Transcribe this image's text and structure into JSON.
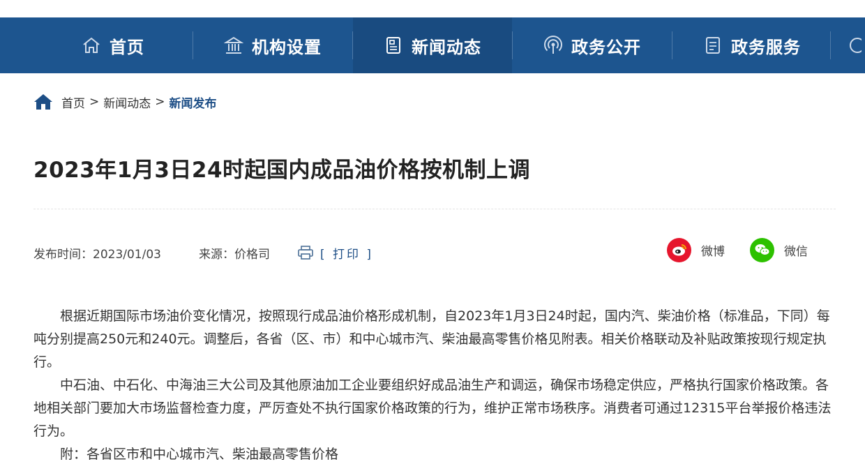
{
  "nav": {
    "items": [
      {
        "label": "首页",
        "icon": "home-outline-icon"
      },
      {
        "label": "机构设置",
        "icon": "institution-icon"
      },
      {
        "label": "新闻动态",
        "icon": "newspaper-icon"
      },
      {
        "label": "政务公开",
        "icon": "broadcast-icon"
      },
      {
        "label": "政务服务",
        "icon": "document-icon"
      }
    ],
    "active_label": "新闻动态"
  },
  "breadcrumb": {
    "home": "首页",
    "separator": ">",
    "section": "新闻动态",
    "current": "新闻发布"
  },
  "article": {
    "title": "2023年1月3日24时起国内成品油价格按机制上调",
    "publish_time": "发布时间：2023/01/03",
    "source": "来源：价格司",
    "print_label": "[ 打印 ]",
    "paragraphs": [
      "根据近期国际市场油价变化情况，按照现行成品油价格形成机制，自2023年1月3日24时起，国内汽、柴油价格（标准品，下同）每吨分别提高250元和240元。调整后，各省（区、市）和中心城市汽、柴油最高零售价格见附表。相关价格联动及补贴政策按现行规定执行。",
      "中石油、中石化、中海油三大公司及其他原油加工企业要组织好成品油生产和调运，确保市场稳定供应，严格执行国家价格政策。各地相关部门要加大市场监督检查力度，严厉查处不执行国家价格政策的行为，维护正常市场秩序。消费者可通过12315平台举报价格违法行为。",
      "附：各省区市和中心城市汽、柴油最高零售价格"
    ]
  },
  "share": {
    "weibo_label": "微博",
    "wechat_label": "微信"
  },
  "colors": {
    "nav_bg": "#1d558f",
    "nav_active_bg": "#194b80",
    "link_blue": "#1d4e86",
    "weibo_red": "#e6162d",
    "wechat_green": "#2dc100"
  }
}
